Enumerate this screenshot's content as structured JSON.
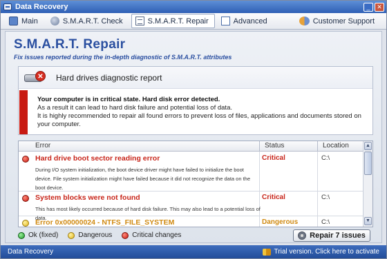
{
  "window": {
    "title": "Data Recovery"
  },
  "nav": {
    "tabs": [
      {
        "label": "Main",
        "icon": "monitor-icon"
      },
      {
        "label": "S.M.A.R.T. Check",
        "icon": "disk-icon"
      },
      {
        "label": "S.M.A.R.T. Repair",
        "icon": "repair-icon",
        "active": true
      },
      {
        "label": "Advanced",
        "icon": "settings-icon"
      }
    ],
    "support": "Customer Support"
  },
  "page": {
    "title": "S.M.A.R.T. Repair",
    "subtitle": "Fix issues reported during the in-depth diagnostic of S.M.A.R.T. attributes"
  },
  "report": {
    "title": "Hard drives diagnostic report",
    "alert_strong": "Your computer is in critical state. Hard disk error detected.",
    "alert_line1": "As a result it can lead to hard disk failure and potential loss of data.",
    "alert_line2": "It is highly recommended to repair all found errors to prevent loss of files, applications and documents stored on your computer."
  },
  "table": {
    "headers": {
      "error": "Error",
      "status": "Status",
      "location": "Location"
    },
    "rows": [
      {
        "title": "Hard drive boot sector reading error",
        "desc": "During I/O system initialization, the boot device driver might have failed to initialize the boot device. File system initialization might have failed because it did not recognize the data on the boot device.",
        "status": "Critical",
        "location": "C:\\"
      },
      {
        "title": "System blocks were not found",
        "desc": "This has most likely occurred because of hard disk failure. This may also lead to a potential loss of data.",
        "status": "Critical",
        "location": "C:\\"
      },
      {
        "title": "Error 0x00000024 - NTFS_FILE_SYSTEM",
        "desc": "",
        "status": "Dangerous",
        "location": "C:\\"
      }
    ]
  },
  "legend": {
    "ok": "Ok (fixed)",
    "dangerous": "Dangerous",
    "critical": "Critical changes"
  },
  "repair_button": "Repair 7 issues",
  "statusbar": {
    "app": "Data Recovery",
    "trial": "Trial version. Click here to activate"
  },
  "colors": {
    "critical": "#c8251a",
    "dangerous": "#d08a12",
    "ok": "#1e9a2a",
    "accent": "#2a4fa0"
  }
}
